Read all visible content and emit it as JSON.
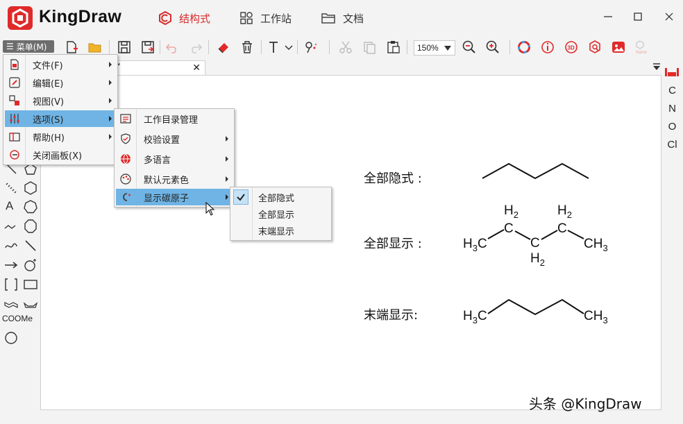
{
  "app": {
    "name": "KingDraw",
    "tabs": [
      {
        "label": "结构式",
        "active": true
      },
      {
        "label": "工作站",
        "active": false
      },
      {
        "label": "文档",
        "active": false
      }
    ],
    "accent_color": "#e02a2a",
    "highlight_color": "#6fb4e4"
  },
  "toolbar": {
    "menu_label": "菜单(M)",
    "zoom": "150%"
  },
  "doc_tab": {
    "title": "*",
    "close": "✕"
  },
  "left_panel": {
    "coome_label": "COOMe",
    "text_tool": "A"
  },
  "right_panel": {
    "elements": [
      "C",
      "N",
      "O",
      "Cl"
    ]
  },
  "menus": {
    "main": {
      "items": [
        {
          "label": "文件(F)"
        },
        {
          "label": "编辑(E)"
        },
        {
          "label": "视图(V)"
        },
        {
          "label": "选项(S)"
        },
        {
          "label": "帮助(H)"
        },
        {
          "label": "关闭画板(X)"
        }
      ]
    },
    "options": {
      "items": [
        {
          "label": "工作目录管理"
        },
        {
          "label": "校验设置"
        },
        {
          "label": "多语言"
        },
        {
          "label": "默认元素色"
        },
        {
          "label": "显示碳原子"
        }
      ]
    },
    "carbon_display": {
      "items": [
        {
          "label": "全部隐式",
          "checked": true
        },
        {
          "label": "全部显示",
          "checked": false
        },
        {
          "label": "末端显示",
          "checked": false
        }
      ]
    }
  },
  "canvas": {
    "labels": {
      "implicit": "全部隐式 :",
      "explicit": "全部显示 :",
      "terminal": "末端显示:"
    },
    "atoms": {
      "h2": "H",
      "h2_sub": "2",
      "c": "C",
      "h3c": "H",
      "h3c_sub": "3",
      "h3c_c": "C",
      "ch3_c": "CH",
      "ch3_sub": "3"
    }
  },
  "watermark": "头条 @KingDraw"
}
